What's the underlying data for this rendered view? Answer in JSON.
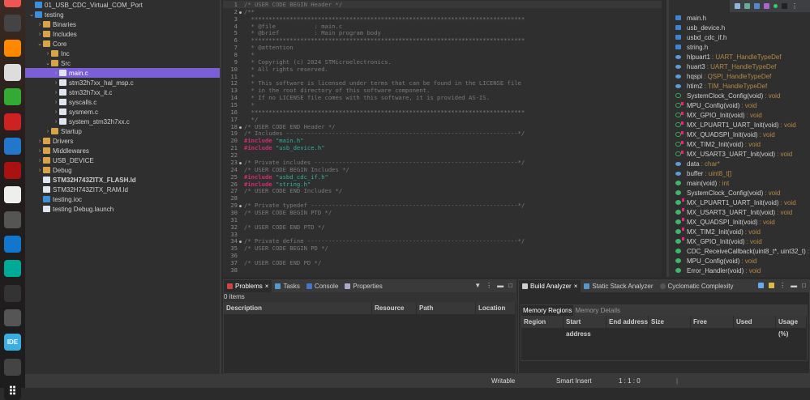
{
  "dock": [
    "firefox",
    "terminal",
    "vlc",
    "document-viewer",
    "libreoffice-calc",
    "xming",
    "remmina",
    "filezilla",
    "text-editor",
    "calculator",
    "vscode",
    "arduino",
    "terminal-2",
    "software-updater",
    "stm32cubeide",
    "trash",
    "apps-grid"
  ],
  "explorer": {
    "items": [
      {
        "label": "01_USB_CDC_Virtual_COM_Port",
        "depth": 0,
        "chev": "",
        "icon": "proj"
      },
      {
        "label": "testing",
        "depth": 0,
        "chev": "v",
        "icon": "proj"
      },
      {
        "label": "Binaries",
        "depth": 1,
        "chev": ">",
        "icon": "folder"
      },
      {
        "label": "Includes",
        "depth": 1,
        "chev": ">",
        "icon": "folder"
      },
      {
        "label": "Core",
        "depth": 1,
        "chev": "v",
        "icon": "folder"
      },
      {
        "label": "Inc",
        "depth": 2,
        "chev": ">",
        "icon": "folder"
      },
      {
        "label": "Src",
        "depth": 2,
        "chev": "v",
        "icon": "folder"
      },
      {
        "label": "main.c",
        "depth": 3,
        "chev": ">",
        "icon": "file",
        "selected": true
      },
      {
        "label": "stm32h7xx_hal_msp.c",
        "depth": 3,
        "chev": ">",
        "icon": "file"
      },
      {
        "label": "stm32h7xx_it.c",
        "depth": 3,
        "chev": ">",
        "icon": "file"
      },
      {
        "label": "syscalls.c",
        "depth": 3,
        "chev": ">",
        "icon": "file"
      },
      {
        "label": "sysmem.c",
        "depth": 3,
        "chev": ">",
        "icon": "file"
      },
      {
        "label": "system_stm32h7xx.c",
        "depth": 3,
        "chev": ">",
        "icon": "file"
      },
      {
        "label": "Startup",
        "depth": 2,
        "chev": ">",
        "icon": "folder"
      },
      {
        "label": "Drivers",
        "depth": 1,
        "chev": ">",
        "icon": "folder"
      },
      {
        "label": "Middlewares",
        "depth": 1,
        "chev": ">",
        "icon": "folder"
      },
      {
        "label": "USB_DEVICE",
        "depth": 1,
        "chev": ">",
        "icon": "folder"
      },
      {
        "label": "Debug",
        "depth": 1,
        "chev": ">",
        "icon": "folder"
      },
      {
        "label": "STM32H743ZITX_FLASH.ld",
        "depth": 1,
        "chev": "",
        "icon": "file",
        "bold": true
      },
      {
        "label": "STM32H743ZITX_RAM.ld",
        "depth": 1,
        "chev": "",
        "icon": "file"
      },
      {
        "label": "testing.ioc",
        "depth": 1,
        "chev": "",
        "icon": "proj"
      },
      {
        "label": "testing Debug.launch",
        "depth": 1,
        "chev": "",
        "icon": "file"
      }
    ]
  },
  "editor": {
    "lines": [
      {
        "n": "1",
        "p": [
          [
            "cm",
            "/* USER CODE BEGIN Header */"
          ]
        ]
      },
      {
        "n": "2",
        "f": true,
        "p": [
          [
            "cm",
            "/**"
          ]
        ]
      },
      {
        "n": "3",
        "p": [
          [
            "cm",
            "  ******************************************************************************"
          ]
        ]
      },
      {
        "n": "4",
        "p": [
          [
            "cm",
            "  * @file           : main.c"
          ]
        ]
      },
      {
        "n": "5",
        "p": [
          [
            "cm",
            "  * @brief          : Main program body"
          ]
        ]
      },
      {
        "n": "6",
        "p": [
          [
            "cm",
            "  ******************************************************************************"
          ]
        ]
      },
      {
        "n": "7",
        "p": [
          [
            "cm",
            "  * @attention"
          ]
        ]
      },
      {
        "n": "8",
        "p": [
          [
            "cm",
            "  *"
          ]
        ]
      },
      {
        "n": "9",
        "p": [
          [
            "cm",
            "  * Copyright (c) 2024 STMicroelectronics."
          ]
        ]
      },
      {
        "n": "10",
        "p": [
          [
            "cm",
            "  * All rights reserved."
          ]
        ]
      },
      {
        "n": "11",
        "p": [
          [
            "cm",
            "  *"
          ]
        ]
      },
      {
        "n": "12",
        "p": [
          [
            "cm",
            "  * This software is licensed under terms that can be found in the LICENSE file"
          ]
        ]
      },
      {
        "n": "13",
        "p": [
          [
            "cm",
            "  * in the root directory of this software component."
          ]
        ]
      },
      {
        "n": "14",
        "p": [
          [
            "cm",
            "  * If no LICENSE file comes with this software, it is provided AS-IS."
          ]
        ]
      },
      {
        "n": "15",
        "p": [
          [
            "cm",
            "  *"
          ]
        ]
      },
      {
        "n": "16",
        "p": [
          [
            "cm",
            "  ******************************************************************************"
          ]
        ]
      },
      {
        "n": "17",
        "p": [
          [
            "cm",
            "  */"
          ]
        ]
      },
      {
        "n": "18",
        "f": true,
        "p": [
          [
            "cm",
            "/* USER CODE END Header */"
          ]
        ]
      },
      {
        "n": "19",
        "p": [
          [
            "cm",
            "/* Includes ------------------------------------------------------------------*/"
          ]
        ]
      },
      {
        "n": "20",
        "p": [
          [
            "kw",
            "#include "
          ],
          [
            "st",
            "\"main.h\""
          ]
        ]
      },
      {
        "n": "21",
        "p": [
          [
            "kw",
            "#include "
          ],
          [
            "st",
            "\"usb_device.h\""
          ]
        ]
      },
      {
        "n": "22",
        "p": []
      },
      {
        "n": "23",
        "f": true,
        "p": [
          [
            "cm",
            "/* Private includes ----------------------------------------------------------*/"
          ]
        ]
      },
      {
        "n": "24",
        "p": [
          [
            "cm",
            "/* USER CODE BEGIN Includes */"
          ]
        ]
      },
      {
        "n": "25",
        "p": [
          [
            "kw",
            "#include "
          ],
          [
            "st",
            "\"usbd_cdc_if.h\""
          ]
        ]
      },
      {
        "n": "26",
        "p": [
          [
            "kw",
            "#include "
          ],
          [
            "st",
            "\"string.h\""
          ]
        ]
      },
      {
        "n": "27",
        "p": [
          [
            "cm",
            "/* USER CODE END Includes */"
          ]
        ]
      },
      {
        "n": "28",
        "p": []
      },
      {
        "n": "29",
        "f": true,
        "p": [
          [
            "cm",
            "/* Private typedef -----------------------------------------------------------*/"
          ]
        ]
      },
      {
        "n": "30",
        "p": [
          [
            "cm",
            "/* USER CODE BEGIN PTD */"
          ]
        ]
      },
      {
        "n": "31",
        "p": []
      },
      {
        "n": "32",
        "p": [
          [
            "cm",
            "/* USER CODE END PTD */"
          ]
        ]
      },
      {
        "n": "33",
        "p": []
      },
      {
        "n": "34",
        "f": true,
        "p": [
          [
            "cm",
            "/* Private define ------------------------------------------------------------*/"
          ]
        ]
      },
      {
        "n": "35",
        "p": [
          [
            "cm",
            "/* USER CODE BEGIN PD */"
          ]
        ]
      },
      {
        "n": "36",
        "p": []
      },
      {
        "n": "37",
        "p": [
          [
            "cm",
            "/* USER CODE END PD */"
          ]
        ]
      },
      {
        "n": "38",
        "p": []
      }
    ]
  },
  "outline": {
    "items": [
      {
        "name": "main.h",
        "type": "",
        "icon": "inc"
      },
      {
        "name": "usb_device.h",
        "type": "",
        "icon": "inc"
      },
      {
        "name": "usbd_cdc_if.h",
        "type": "",
        "icon": "inc"
      },
      {
        "name": "string.h",
        "type": "",
        "icon": "inc"
      },
      {
        "name": "hlpuart1",
        "type": ": UART_HandleTypeDef",
        "icon": "var"
      },
      {
        "name": "huart3",
        "type": ": UART_HandleTypeDef",
        "icon": "var"
      },
      {
        "name": "hqspi",
        "type": ": QSPI_HandleTypeDef",
        "icon": "var"
      },
      {
        "name": "htim2",
        "type": ": TIM_HandleTypeDef",
        "icon": "var"
      },
      {
        "name": "SystemClock_Config(void)",
        "type": ": void",
        "icon": "fpriv"
      },
      {
        "name": "MPU_Config(void)",
        "type": ": void",
        "icon": "fpriv",
        "mk": true
      },
      {
        "name": "MX_GPIO_Init(void)",
        "type": ": void",
        "icon": "fpriv",
        "mk": true
      },
      {
        "name": "MX_LPUART1_UART_Init(void)",
        "type": ": void",
        "icon": "fpriv",
        "mk": true
      },
      {
        "name": "MX_QUADSPI_Init(void)",
        "type": ": void",
        "icon": "fpriv",
        "mk": true
      },
      {
        "name": "MX_TIM2_Init(void)",
        "type": ": void",
        "icon": "fpriv",
        "mk": true
      },
      {
        "name": "MX_USART3_UART_Init(void)",
        "type": ": void",
        "icon": "fpriv",
        "mk": true
      },
      {
        "name": "data",
        "type": ": char*",
        "icon": "var"
      },
      {
        "name": "buffer",
        "type": ": uint8_t[]",
        "icon": "var"
      },
      {
        "name": "main(void)",
        "type": ": int",
        "icon": "fpub"
      },
      {
        "name": "SystemClock_Config(void)",
        "type": ": void",
        "icon": "fpub"
      },
      {
        "name": "MX_LPUART1_UART_Init(void)",
        "type": ": void",
        "icon": "fpub",
        "mk": true
      },
      {
        "name": "MX_USART3_UART_Init(void)",
        "type": ": void",
        "icon": "fpub",
        "mk": true
      },
      {
        "name": "MX_QUADSPI_Init(void)",
        "type": ": void",
        "icon": "fpub",
        "mk": true
      },
      {
        "name": "MX_TIM2_Init(void)",
        "type": ": void",
        "icon": "fpub",
        "mk": true
      },
      {
        "name": "MX_GPIO_Init(void)",
        "type": ": void",
        "icon": "fpub",
        "mk": true
      },
      {
        "name": "CDC_ReceiveCallback(uint8_t*, uint32_t)",
        "type": ": void",
        "icon": "fpub"
      },
      {
        "name": "MPU_Config(void)",
        "type": ": void",
        "icon": "fpub"
      },
      {
        "name": "Error_Handler(void)",
        "type": ": void",
        "icon": "fpub"
      }
    ]
  },
  "problems": {
    "tabs": [
      "Problems",
      "Tasks",
      "Console",
      "Properties"
    ],
    "count": "0 items",
    "columns": [
      "Description",
      "Resource",
      "Path",
      "Location"
    ]
  },
  "build": {
    "tabs": [
      "Build Analyzer",
      "Static Stack Analyzer",
      "Cyclomatic Complexity"
    ],
    "subtabs": [
      "Memory Regions",
      "Memory Details"
    ],
    "columns": [
      "Region",
      "Start address",
      "End address",
      "Size",
      "Free",
      "Used",
      "Usage (%)"
    ]
  },
  "status": {
    "writable": "Writable",
    "insert": "Smart Insert",
    "position": "1 : 1 : 0"
  }
}
